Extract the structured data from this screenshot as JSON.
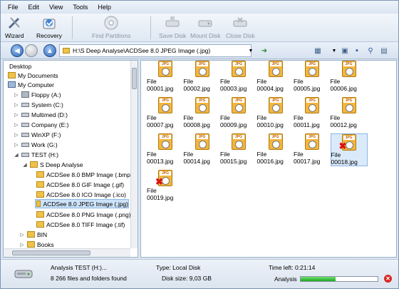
{
  "menu": [
    "File",
    "Edit",
    "View",
    "Tools",
    "Help"
  ],
  "toolbar": {
    "wizard": "Wizard",
    "recovery": "Recovery",
    "find_partitions": "Find Partitions",
    "save_disk": "Save Disk",
    "mount_disk": "Mount Disk",
    "close_disk": "Close Disk"
  },
  "address": {
    "path": "H:\\S Deep Analyse\\ACDSee 8.0 JPEG Image (.jpg)"
  },
  "tree": [
    "Desktop",
    "My Documents",
    "My Computer",
    "Floppy (A:)",
    "System (C:)",
    "Multimed (D:)",
    "Company (E:)",
    "WinXP (F:)",
    "Work (G:)",
    "TEST (H:)",
    "S Deep Analyse",
    "ACDSee 8.0 BMP Image (.bmp)",
    "ACDSee 8.0 GIF Image (.gif)",
    "ACDSee 8.0 ICO Image (.ico)",
    "ACDSee 8.0 JPEG Image (.jpg)",
    "ACDSee 8.0 PNG Image (.png)",
    "ACDSee 8.0 TIFF Image (.tif)",
    "BIN",
    "Books"
  ],
  "files": [
    "File 00001.jpg",
    "File 00002.jpg",
    "File 00003.jpg",
    "File 00004.jpg",
    "File 00005.jpg",
    "File 00006.jpg",
    "File 00007.jpg",
    "File 00008.jpg",
    "File 00009.jpg",
    "File 00010.jpg",
    "File 00011.jpg",
    "File 00012.jpg",
    "File 00013.jpg",
    "File 00014.jpg",
    "File 00015.jpg",
    "File 00016.jpg",
    "File 00017.jpg",
    "File 00018.jpg",
    "File 00019.jpg"
  ],
  "status": {
    "title": "Analysis TEST (H:)...",
    "count": "8 266 files and folders found",
    "type": "Type: Local Disk",
    "size": "Disk size: 9,03 GB",
    "time": "Time left: 0:21:14",
    "analysis_label": "Analysis",
    "progress": 0.45
  },
  "colors": {
    "accent": "#2c63b8",
    "folder": "#f0c24a",
    "deleted": "#d11111"
  }
}
